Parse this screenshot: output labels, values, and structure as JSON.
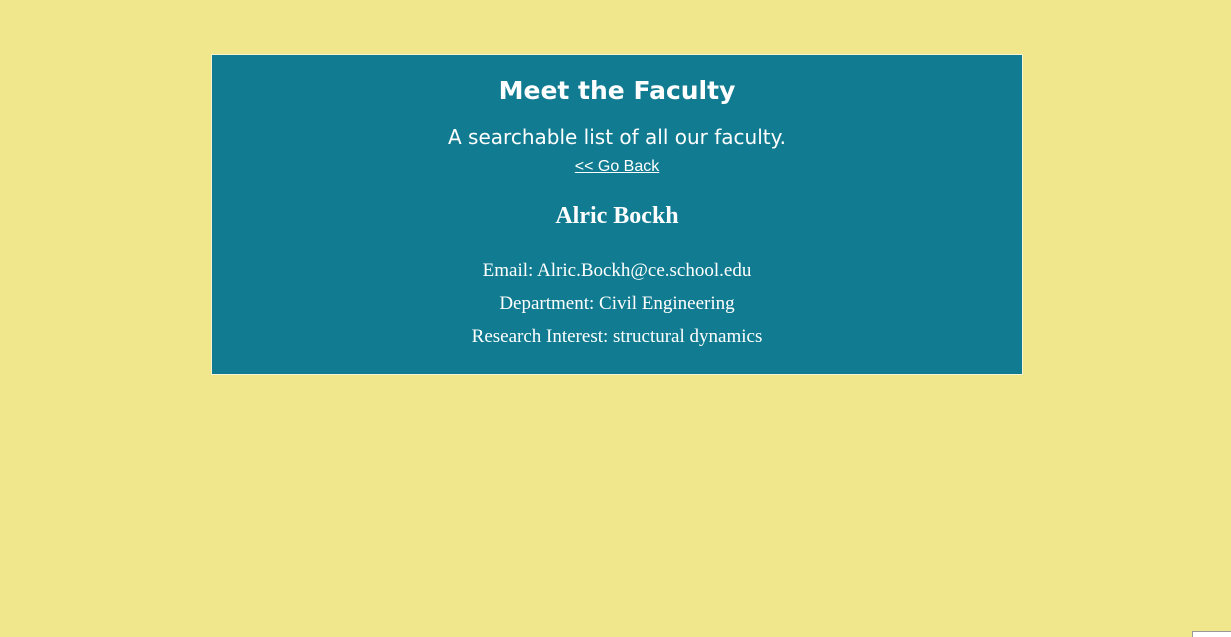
{
  "header": {
    "title": "Meet the Faculty",
    "subtitle": "A searchable list of all our faculty.",
    "back_link": "<< Go Back"
  },
  "faculty": {
    "name": "Alric Bockh",
    "email": "Email: Alric.Bockh@ce.school.edu",
    "department": "Department: Civil Engineering",
    "research": "Research Interest: structural dynamics"
  },
  "colors": {
    "page_background": "#f0e68c",
    "card_background": "#117c91",
    "text": "#ffffff"
  }
}
